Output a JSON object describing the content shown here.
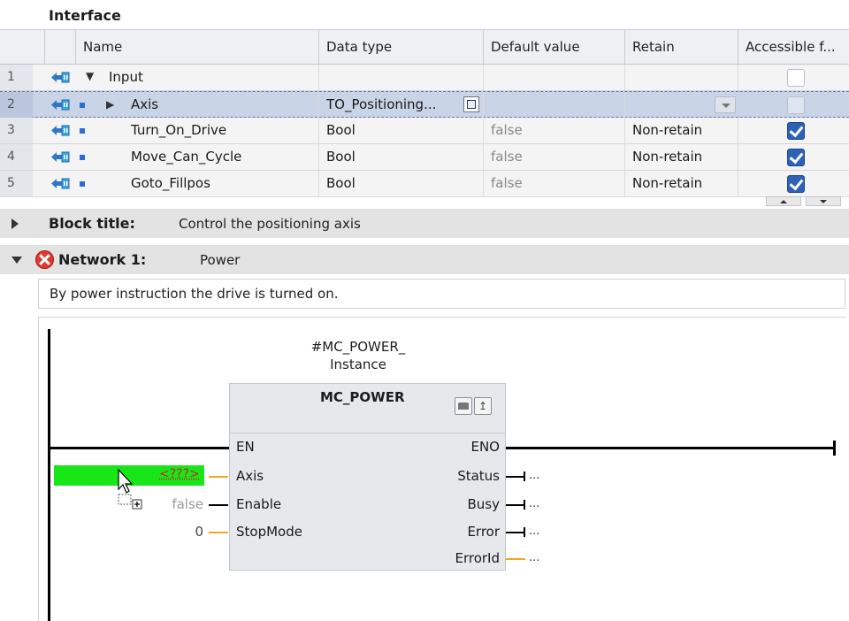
{
  "interface": {
    "title": "Interface",
    "columns": [
      "Name",
      "Data type",
      "Default value",
      "Retain",
      "Accessible f..."
    ],
    "rows": [
      {
        "num": "1",
        "name": "Input",
        "type": "",
        "default": "",
        "retain": "",
        "accessible": false
      },
      {
        "num": "2",
        "name": "Axis",
        "type": "TO_Positioning...",
        "default": "",
        "retain": "",
        "accessible": false
      },
      {
        "num": "3",
        "name": "Turn_On_Drive",
        "type": "Bool",
        "default": "false",
        "retain": "Non-retain",
        "accessible": true
      },
      {
        "num": "4",
        "name": "Move_Can_Cycle",
        "type": "Bool",
        "default": "false",
        "retain": "Non-retain",
        "accessible": true
      },
      {
        "num": "5",
        "name": "Goto_Fillpos",
        "type": "Bool",
        "default": "false",
        "retain": "Non-retain",
        "accessible": true
      }
    ]
  },
  "block": {
    "label": "Block title:",
    "title": "Control the positioning axis"
  },
  "network": {
    "label": "Network 1:",
    "title": "Power",
    "comment": "By power instruction the drive is turned on.",
    "status": "error"
  },
  "fb": {
    "instance_line1": "#MC_POWER_",
    "instance_line2": "Instance",
    "name": "MC_POWER",
    "inputs": {
      "en": "EN",
      "axis": "Axis",
      "enable": "Enable",
      "stopmode": "StopMode"
    },
    "outputs": {
      "eno": "ENO",
      "status": "Status",
      "busy": "Busy",
      "error": "Error",
      "errorid": "ErrorId"
    },
    "input_values": {
      "axis": "<???>",
      "enable": "false",
      "stopmode": "0"
    },
    "output_values": {
      "status": "...",
      "busy": "...",
      "error": "...",
      "errorid": "..."
    }
  },
  "colors": {
    "selection_row": "#c9d4e6",
    "green_placeholder": "#19e619",
    "orange_wire": "#f5a623",
    "checkbox_on": "#2e62b6",
    "error_icon": "#e03a2d"
  },
  "icons": [
    "input-icon",
    "expand-arrow-icon",
    "collapse-arrow-icon",
    "browse-icon",
    "dropdown-icon",
    "checkbox-icon",
    "error-icon",
    "fb-info-icon",
    "fb-diagnostics-icon",
    "drag-cursor-icon"
  ]
}
